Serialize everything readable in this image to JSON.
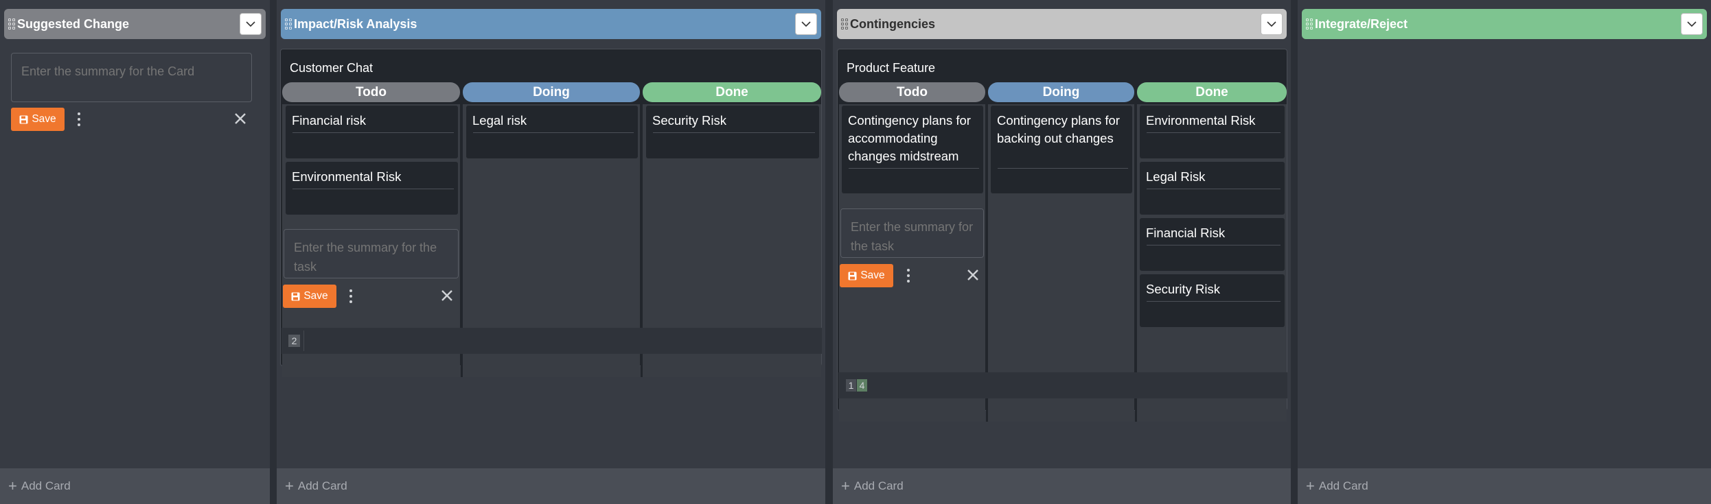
{
  "colors": {
    "background": "#2b2f36",
    "lane": "#373b43",
    "suggested_header": "#7f8186",
    "impact_header": "#6895bd",
    "contingencies_header": "#c4c4c4",
    "integrate_header": "#7ec490",
    "todo": "#777a80",
    "doing": "#6b93bd",
    "done": "#7ec490",
    "save": "#f0772e"
  },
  "icons": {
    "grip": "grip-dots-icon",
    "collapse": "chevron-down-icon",
    "save": "floppy-disk-icon",
    "more": "kebab-menu-icon",
    "close": "close-x-icon",
    "add": "plus-icon"
  },
  "add_card_label": "Add Card",
  "save_label": "Save",
  "lanes": [
    {
      "title": "Suggested Change",
      "new_card_placeholder": "Enter the summary for the Card"
    },
    {
      "title": "Impact/Risk Analysis",
      "card": {
        "title": "Customer Chat",
        "columns": [
          {
            "name": "Todo",
            "tasks": [
              "Financial risk",
              "Environmental Risk"
            ]
          },
          {
            "name": "Doing",
            "tasks": [
              "Legal risk"
            ]
          },
          {
            "name": "Done",
            "tasks": [
              "Security Risk"
            ]
          }
        ],
        "new_task_placeholder": "Enter the summary for the task",
        "pages": [
          "2"
        ]
      }
    },
    {
      "title": "Contingencies",
      "card": {
        "title": "Product Feature",
        "columns": [
          {
            "name": "Todo",
            "tasks": [
              "Contingency plans for accommodating changes midstream"
            ]
          },
          {
            "name": "Doing",
            "tasks": [
              "Contingency plans for backing out changes"
            ]
          },
          {
            "name": "Done",
            "tasks": [
              "Environmental Risk",
              "Legal Risk",
              "Financial Risk",
              "Security Risk"
            ]
          }
        ],
        "new_task_placeholder": "Enter the summary for the task",
        "pages": [
          "1",
          "4"
        ]
      }
    },
    {
      "title": "Integrate/Reject"
    }
  ]
}
